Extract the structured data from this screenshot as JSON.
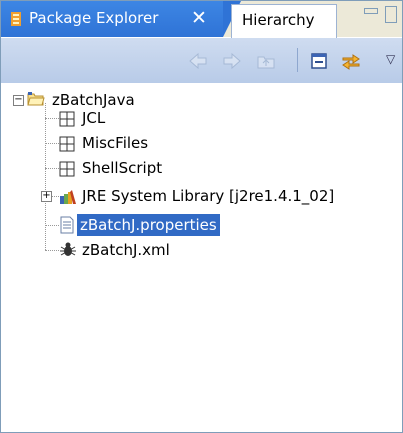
{
  "tabs": {
    "active_title": "Package Explorer",
    "close_symbol": "✕",
    "inactive_title": "Hierarchy"
  },
  "toolbar": {
    "back_icon": "back-arrow-icon",
    "forward_icon": "forward-arrow-icon",
    "up_icon": "up-folder-icon",
    "collapse_icon": "collapse-all-icon",
    "link_icon": "link-with-editor-icon",
    "view_menu_symbol": "▽"
  },
  "tree": {
    "project": {
      "label": "zBatchJava",
      "expanded": true
    },
    "items": [
      {
        "label": "JCL",
        "icon": "package-icon"
      },
      {
        "label": "MiscFiles",
        "icon": "package-icon"
      },
      {
        "label": "ShellScript",
        "icon": "package-icon"
      },
      {
        "label": "JRE System Library [j2re1.4.1_02]",
        "icon": "library-icon",
        "expandable": true
      },
      {
        "label": "zBatchJ.properties",
        "icon": "properties-file-icon",
        "selected": true
      },
      {
        "label": "zBatchJ.xml",
        "icon": "xml-file-icon"
      }
    ]
  },
  "colors": {
    "active_tab": "#2f73d6",
    "selection": "#316ac5",
    "toolbar": "#c4d4ec"
  }
}
